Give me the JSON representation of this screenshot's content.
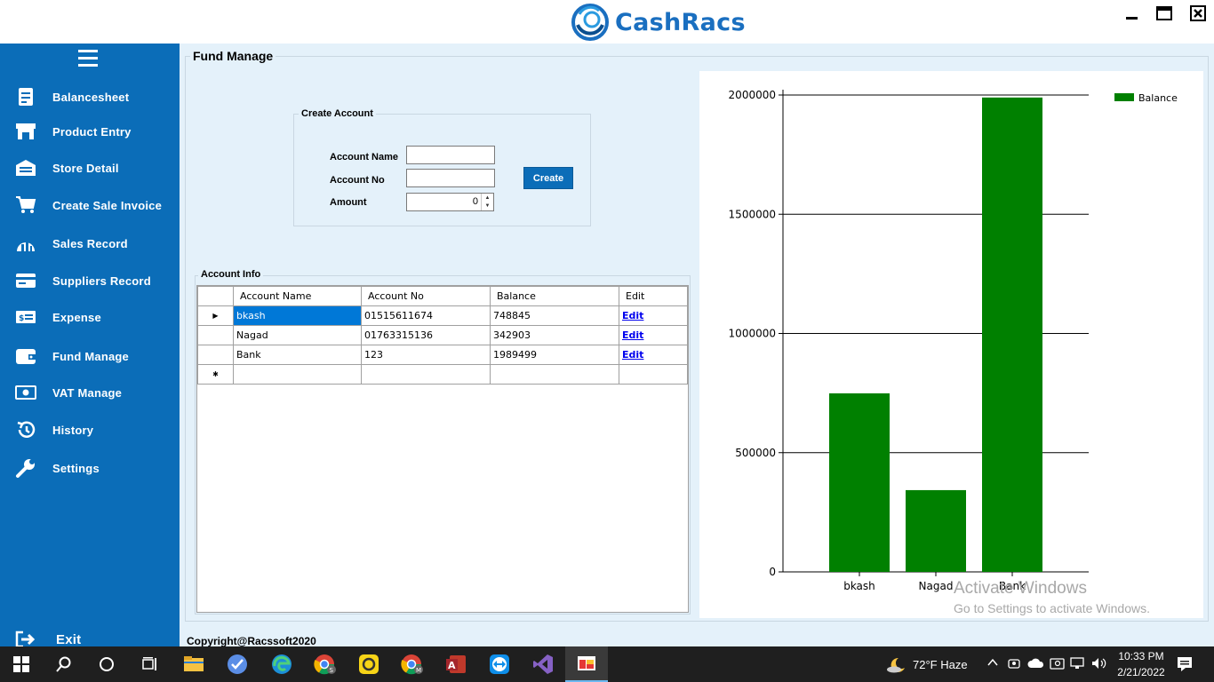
{
  "app": {
    "title": "CashRacs",
    "colors": {
      "sidebar": "#0b6db8",
      "accent": "#0b6db8",
      "bar": "#008000"
    }
  },
  "sidebar": {
    "items": [
      {
        "label": "Balancesheet",
        "icon": "balancesheet-icon"
      },
      {
        "label": "Product Entry",
        "icon": "store-icon"
      },
      {
        "label": "Store Detail",
        "icon": "warehouse-icon"
      },
      {
        "label": "Create Sale Invoice",
        "icon": "cart-icon"
      },
      {
        "label": "Sales Record",
        "icon": "chart-icon"
      },
      {
        "label": "Suppliers Record",
        "icon": "card-icon"
      },
      {
        "label": "Expense",
        "icon": "money-icon"
      },
      {
        "label": "Fund Manage",
        "icon": "wallet-icon"
      },
      {
        "label": "VAT Manage",
        "icon": "cash-icon"
      },
      {
        "label": "History",
        "icon": "history-icon"
      },
      {
        "label": "Settings",
        "icon": "wrench-icon"
      }
    ],
    "exit_label": "Exit"
  },
  "main": {
    "group_title": "Fund Manage",
    "create": {
      "title": "Create Account",
      "account_name_label": "Account Name",
      "account_no_label": "Account No",
      "amount_label": "Amount",
      "account_name_value": "",
      "account_no_value": "",
      "amount_value": "0",
      "create_button": "Create"
    },
    "account_info": {
      "title": "Account Info",
      "columns": [
        "Account Name",
        "Account No",
        "Balance",
        "Edit"
      ],
      "rows": [
        {
          "name": "bkash",
          "number": "01515611674",
          "balance": "748845",
          "edit": "Edit"
        },
        {
          "name": "Nagad",
          "number": "01763315136",
          "balance": "342903",
          "edit": "Edit"
        },
        {
          "name": "Bank",
          "number": "123",
          "balance": "1989499",
          "edit": "Edit"
        }
      ]
    }
  },
  "chart_data": {
    "type": "bar",
    "categories": [
      "bkash",
      "Nagad",
      "Bank"
    ],
    "series": [
      {
        "name": "Balance",
        "values": [
          748845,
          342903,
          1989499
        ]
      }
    ],
    "ylim": [
      0,
      2000000
    ],
    "yticks": [
      0,
      500000,
      1000000,
      1500000,
      2000000
    ],
    "grid": true,
    "legend": "top-right"
  },
  "watermark": {
    "line1": "Activate Windows",
    "line2": "Go to Settings to activate Windows."
  },
  "footer": {
    "copyright": "Copyright@Racssoft2020"
  },
  "taskbar": {
    "weather": "72°F  Haze",
    "time": "10:33 PM",
    "date": "2/21/2022"
  }
}
